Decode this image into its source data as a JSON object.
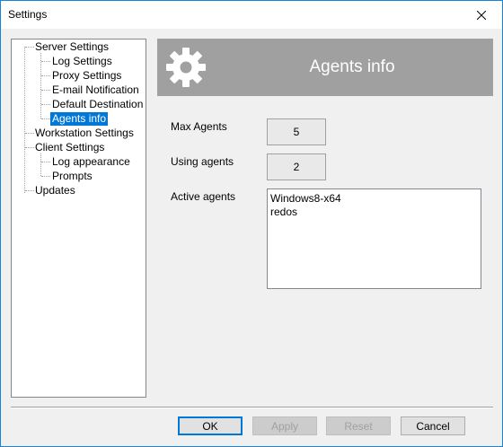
{
  "window": {
    "title": "Settings"
  },
  "tree": {
    "items": [
      {
        "label": "Server Settings"
      },
      {
        "label": "Log Settings"
      },
      {
        "label": "Proxy Settings"
      },
      {
        "label": "E-mail Notification"
      },
      {
        "label": "Default Destination"
      },
      {
        "label": "Agents info",
        "selected": true
      },
      {
        "label": "Workstation Settings"
      },
      {
        "label": "Client Settings"
      },
      {
        "label": "Log appearance"
      },
      {
        "label": "Prompts"
      },
      {
        "label": "Updates"
      }
    ]
  },
  "panel": {
    "header_title": "Agents info",
    "header_icon": "gear-icon",
    "max_agents_label": "Max Agents",
    "max_agents_value": "5",
    "using_agents_label": "Using agents",
    "using_agents_value": "2",
    "active_agents_label": "Active agents",
    "active_agents": [
      "Windows8-x64",
      "redos"
    ]
  },
  "buttons": {
    "ok": "OK",
    "apply": "Apply",
    "reset": "Reset",
    "cancel": "Cancel"
  },
  "colors": {
    "accent": "#0078d7",
    "header_bg": "#a0a0a0",
    "window_border": "#1883d7"
  }
}
